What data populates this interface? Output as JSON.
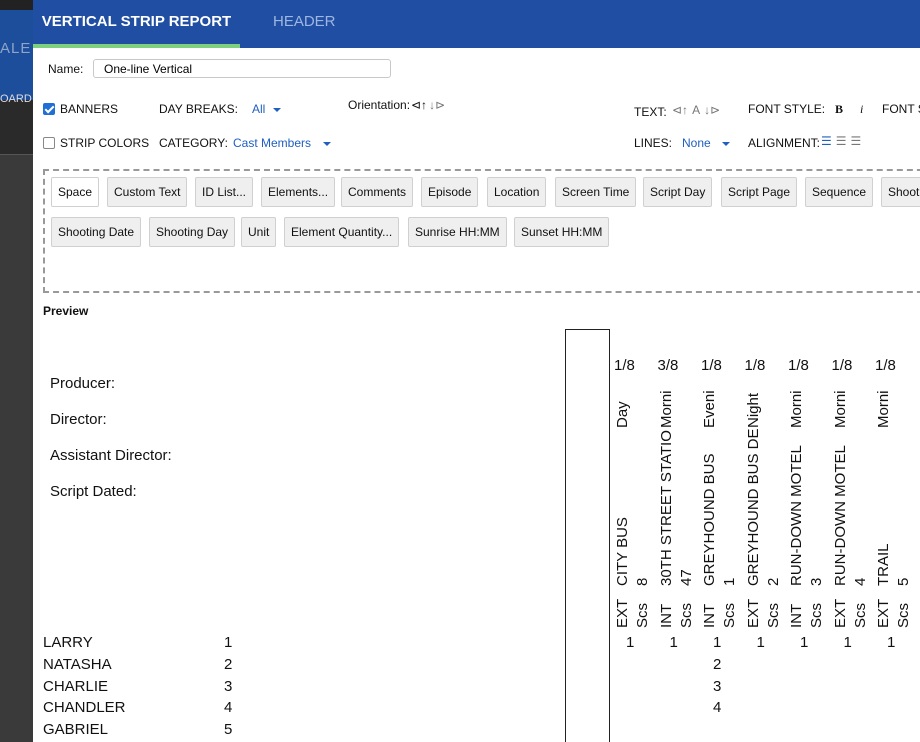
{
  "background_app": {
    "text_ale": "ALE",
    "text_oard": "OARD"
  },
  "tabs": [
    {
      "label": "VERTICAL STRIP REPORT"
    },
    {
      "label": "HEADER"
    }
  ],
  "form": {
    "name_label": "Name:",
    "name_value": "One-line Vertical",
    "banners": {
      "label": "BANNERS",
      "checked": true
    },
    "strip_colors": {
      "label": "STRIP COLORS",
      "checked": false
    },
    "day_breaks": {
      "label": "DAY BREAKS:",
      "value": "All"
    },
    "category": {
      "label": "CATEGORY:",
      "value": "Cast Members"
    },
    "orientation": {
      "label": "Orientation:"
    },
    "text": {
      "label": "TEXT:"
    },
    "lines": {
      "label": "LINES:",
      "value": "None"
    },
    "font_style": {
      "label": "FONT STYLE:",
      "bold": "B",
      "italic": "i"
    },
    "font_size": {
      "label": "FONT S"
    },
    "alignment": {
      "label": "ALIGNMENT:"
    }
  },
  "field_buttons": {
    "row1": [
      "Space",
      "Custom Text",
      "ID List...",
      "Elements...",
      "Comments",
      "Episode",
      "Location",
      "Screen Time",
      "Script Day",
      "Script Page",
      "Sequence",
      "Shoot"
    ],
    "row2": [
      "Shooting Date",
      "Shooting Day",
      "Unit",
      "Element Quantity...",
      "Sunrise HH:MM",
      "Sunset HH:MM"
    ]
  },
  "preview": {
    "label": "Preview",
    "header_labels": [
      "Producer:",
      "Director:",
      "Assistant Director:",
      "Script Dated:"
    ],
    "cast": [
      {
        "name": "LARRY",
        "id": "1"
      },
      {
        "name": "NATASHA",
        "id": "2"
      },
      {
        "name": "CHARLIE",
        "id": "3"
      },
      {
        "name": "CHANDLER",
        "id": "4"
      },
      {
        "name": "GABRIEL",
        "id": "5"
      }
    ],
    "strips": [
      {
        "pages": "1/8",
        "time": "Day",
        "int_ext": "EXT",
        "location": "CITY BUS",
        "scs": "Scs",
        "scene": "8",
        "cast_rows": [
          "1"
        ]
      },
      {
        "pages": "3/8",
        "time": "Morni",
        "int_ext": "INT",
        "location": "30TH STREET STATIO",
        "scs": "Scs",
        "scene": "47",
        "cast_rows": [
          "1"
        ]
      },
      {
        "pages": "1/8",
        "time": "Eveni",
        "int_ext": "INT",
        "location": "GREYHOUND BUS",
        "scs": "Scs",
        "scene": "1",
        "cast_rows": [
          "1",
          "2",
          "3",
          "4"
        ]
      },
      {
        "pages": "1/8",
        "time": "Night",
        "int_ext": "EXT",
        "location": "GREYHOUND BUS DE",
        "scs": "Scs",
        "scene": "2",
        "cast_rows": [
          "1"
        ]
      },
      {
        "pages": "1/8",
        "time": "Morni",
        "int_ext": "INT",
        "location": "RUN-DOWN MOTEL",
        "scs": "Scs",
        "scene": "3",
        "cast_rows": [
          "1"
        ]
      },
      {
        "pages": "1/8",
        "time": "Morni",
        "int_ext": "EXT",
        "location": "RUN-DOWN MOTEL",
        "scs": "Scs",
        "scene": "4",
        "cast_rows": [
          "1"
        ]
      },
      {
        "pages": "1/8",
        "time": "Morni",
        "int_ext": "EXT",
        "location": "TRAIL",
        "scs": "Scs",
        "scene": "5",
        "cast_rows": [
          "1"
        ]
      }
    ]
  },
  "colors": {
    "header_blue": "#1f4ea3",
    "active_tab_underline": "#7dd07d",
    "link_blue": "#1f5fbf"
  }
}
